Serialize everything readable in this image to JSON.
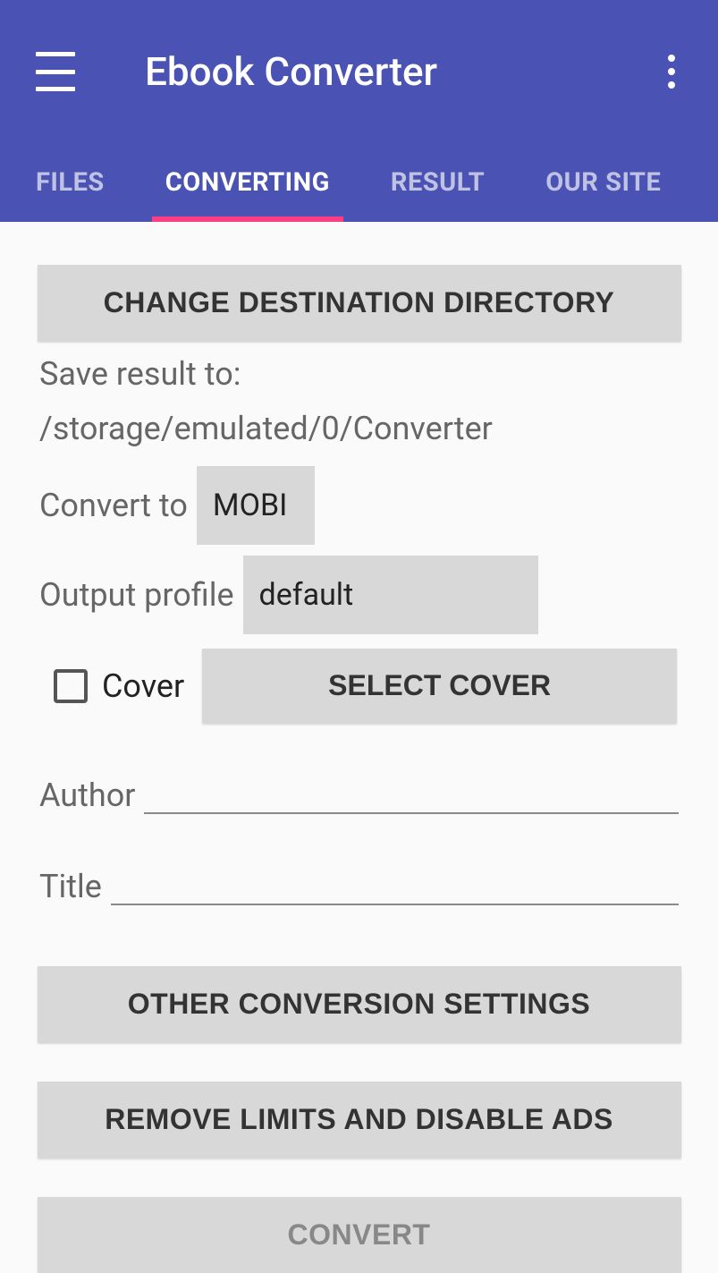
{
  "header": {
    "title": "Ebook Converter",
    "tabs": [
      {
        "label": "FILES"
      },
      {
        "label": "CONVERTING"
      },
      {
        "label": "RESULT"
      },
      {
        "label": "OUR SITE"
      }
    ],
    "active_tab": 1
  },
  "main": {
    "change_dir_label": "CHANGE DESTINATION DIRECTORY",
    "save_path_text": "Save result to: /storage/emulated/0/Converter",
    "convert_to_label": "Convert to",
    "convert_to_value": "MOBI",
    "output_profile_label": "Output profile",
    "output_profile_value": "default",
    "cover_checkbox_label": "Cover",
    "cover_checked": false,
    "select_cover_label": "SELECT COVER",
    "author_label": "Author",
    "author_value": "",
    "title_label": "Title",
    "title_value": "",
    "other_settings_label": "OTHER CONVERSION SETTINGS",
    "remove_limits_label": "REMOVE LIMITS AND DISABLE ADS",
    "convert_label": "CONVERT",
    "convert_enabled": false
  }
}
